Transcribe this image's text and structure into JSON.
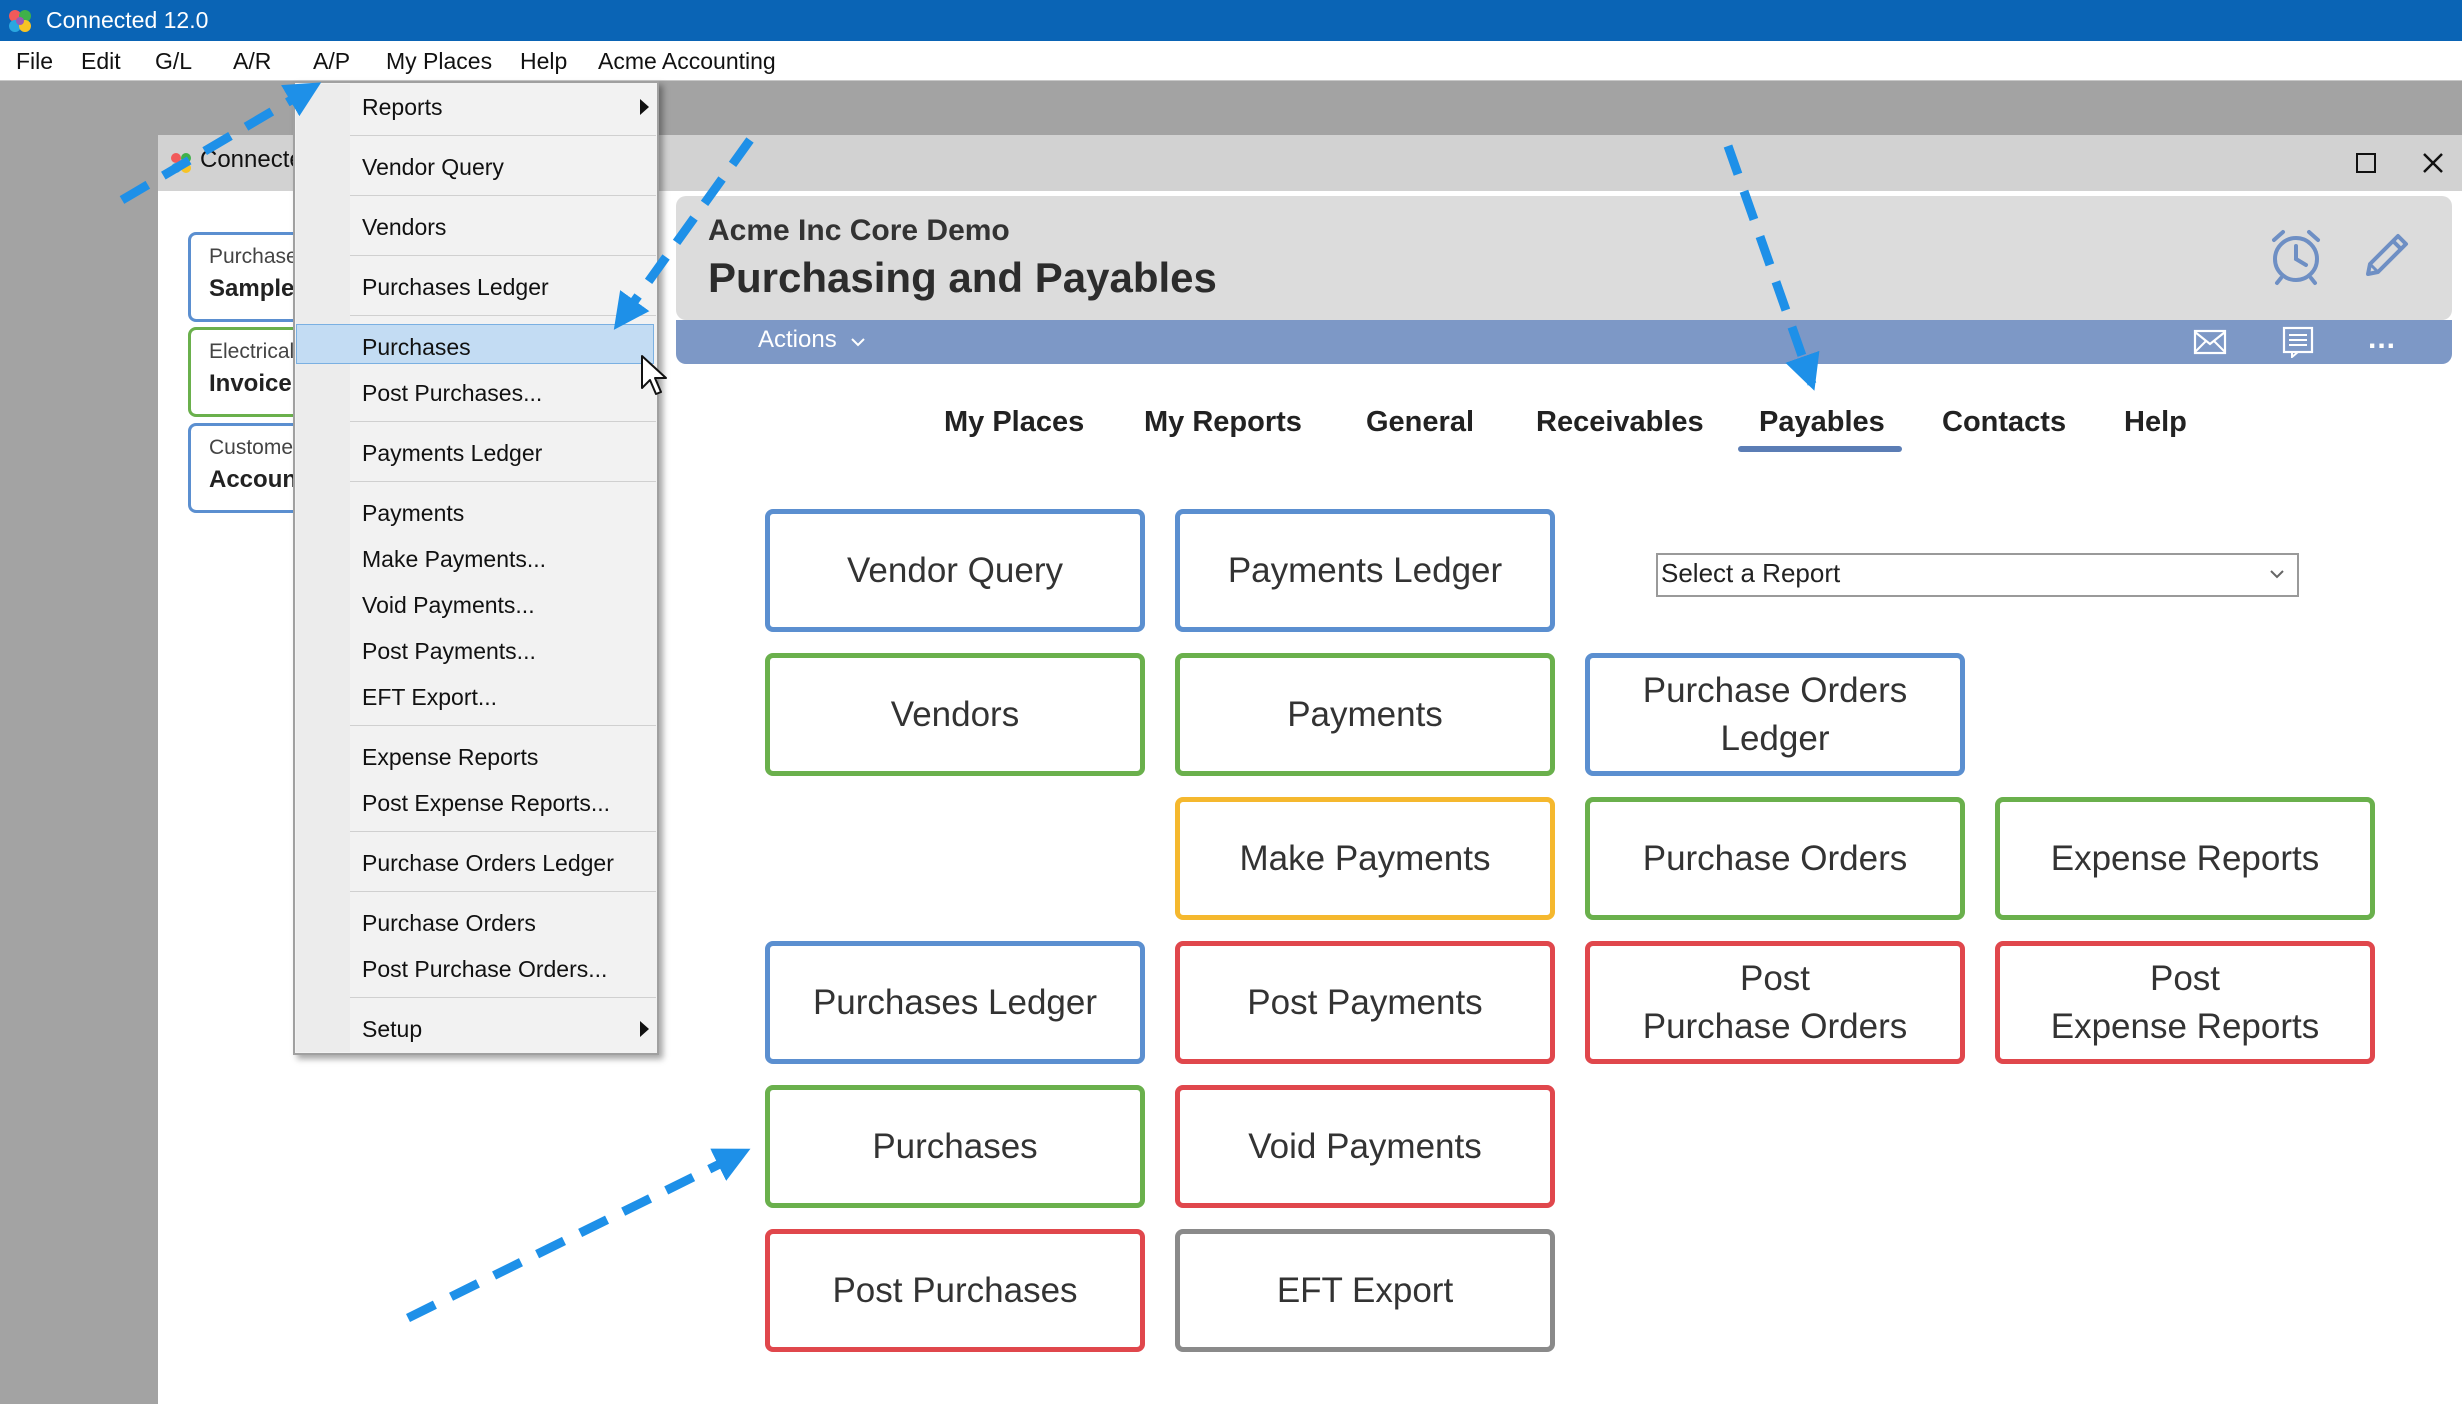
{
  "app": {
    "title": "Connected 12.0"
  },
  "menubar": {
    "items": [
      "File",
      "Edit",
      "G/L",
      "A/R",
      "A/P",
      "My Places",
      "Help",
      "Acme Accounting"
    ]
  },
  "child_window": {
    "title": "Connecte",
    "cards": [
      {
        "line1": "Purchase",
        "line2": "Sample",
        "color": "#5b8fd0"
      },
      {
        "line1": "Electrical",
        "line2": "Invoice",
        "color": "#6ab04c"
      },
      {
        "line1": "Customer",
        "line2": "Accoun",
        "color": "#5b8fd0"
      }
    ]
  },
  "dropdown": {
    "items": {
      "reports": "Reports",
      "vendor_query": "Vendor Query",
      "vendors": "Vendors",
      "purchases_ledger": "Purchases Ledger",
      "purchases": "Purchases",
      "post_purchases": "Post Purchases...",
      "payments_ledger": "Payments Ledger",
      "payments": "Payments",
      "make_payments": "Make Payments...",
      "void_payments": "Void Payments...",
      "post_payments": "Post Payments...",
      "eft_export": "EFT Export...",
      "expense_reports": "Expense Reports",
      "post_expense_reports": "Post Expense Reports...",
      "purchase_orders_ledger": "Purchase Orders Ledger",
      "purchase_orders": "Purchase Orders",
      "post_purchase_orders": "Post Purchase Orders...",
      "setup": "Setup"
    },
    "highlighted": "Purchases"
  },
  "header": {
    "company": "Acme Inc Core Demo",
    "title": "Purchasing and Payables",
    "actions_label": "Actions",
    "more_label": "..."
  },
  "tabs": [
    "My Places",
    "My Reports",
    "General",
    "Receivables",
    "Payables",
    "Contacts",
    "Help"
  ],
  "active_tab": "Payables",
  "report_select": {
    "value": "Select a Report"
  },
  "tiles": {
    "vendor_query": {
      "label": "Vendor Query",
      "color": "#5b8fd0"
    },
    "payments_ledger": {
      "label": "Payments Ledger",
      "color": "#5b8fd0"
    },
    "vendors": {
      "label": "Vendors",
      "color": "#6ab04c"
    },
    "payments": {
      "label": "Payments",
      "color": "#6ab04c"
    },
    "purchase_orders_ledger": {
      "label": "Purchase Orders\nLedger",
      "color": "#5b8fd0"
    },
    "make_payments": {
      "label": "Make Payments",
      "color": "#f5b82e"
    },
    "purchase_orders": {
      "label": "Purchase Orders",
      "color": "#6ab04c"
    },
    "expense_reports": {
      "label": "Expense Reports",
      "color": "#6ab04c"
    },
    "purchases_ledger": {
      "label": "Purchases Ledger",
      "color": "#5b8fd0"
    },
    "post_payments": {
      "label": "Post Payments",
      "color": "#e0474c"
    },
    "post_purchase_orders": {
      "label": "Post\nPurchase Orders",
      "color": "#e0474c"
    },
    "post_expense_reports": {
      "label": "Post\nExpense Reports",
      "color": "#e0474c"
    },
    "purchases": {
      "label": "Purchases",
      "color": "#6ab04c"
    },
    "void_payments": {
      "label": "Void Payments",
      "color": "#e0474c"
    },
    "post_purchases": {
      "label": "Post Purchases",
      "color": "#e0474c"
    },
    "eft_export": {
      "label": "EFT Export",
      "color": "#8a8a8a"
    }
  },
  "colors": {
    "titlebar": "#0a64b5",
    "action_bar": "#7d98c6",
    "tab_underline": "#5b7db5",
    "annotation_arrow": "#1e90e8",
    "menu_highlight": "#c3dcf3"
  }
}
